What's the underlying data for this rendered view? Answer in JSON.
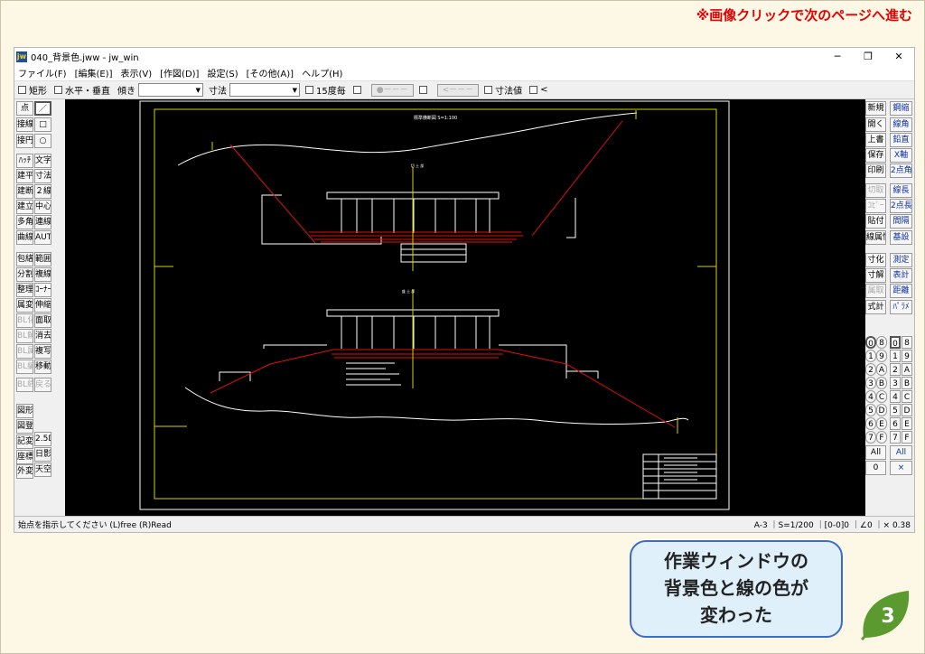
{
  "notice": "※画像クリックで次のページへ進む",
  "window": {
    "title": "040_背景色.jww - jw_win",
    "app_icon": "jw",
    "controls": [
      "─",
      "❐",
      "✕"
    ]
  },
  "menu": [
    "ファイル(F)",
    "[編集(E)]",
    "表示(V)",
    "[作図(D)]",
    "設定(S)",
    "[その他(A)]",
    "ヘルプ(H)"
  ],
  "toolbar": {
    "rect": "矩形",
    "hv": "水平・垂直",
    "tilt": "傾き",
    "dim": "寸法",
    "deg15": "15度毎",
    "circle_btn": "●－－－",
    "arrow_btn": "<－－－",
    "dimval": "寸法値",
    "lt": "<"
  },
  "left_tools": [
    "点",
    "／",
    "接線",
    "□",
    "接円",
    "○",
    "ﾊｯﾁ",
    "文字",
    "建平",
    "寸法",
    "建断",
    "２線",
    "建立",
    "中心線",
    "多角形",
    "連線",
    "曲線",
    "AUTO",
    "包絡",
    "範囲",
    "分割",
    "複線",
    "整理",
    "ｺｰﾅｰ",
    "属変",
    "伸縮",
    "BL化",
    "面取",
    "BL解",
    "消去",
    "BL属",
    "複写",
    "BL編",
    "移動",
    "BL終",
    "戻る",
    "図形",
    "図登",
    "記変",
    "2.5D",
    "座標",
    "日影",
    "外変",
    "天空"
  ],
  "right_tools": [
    "新規",
    "開く",
    "上書",
    "保存",
    "印刷",
    "切取",
    "ｺﾋﾟｰ",
    "貼付",
    "線属性",
    "寸化",
    "寸解",
    "属取",
    "式計",
    "All",
    "0"
  ],
  "right_tools2": [
    "鋼縮",
    "線角",
    "鉛直",
    "X軸",
    "2点角",
    "線長",
    "2点長",
    "間隔",
    "基設",
    "測定",
    "表計",
    "距離",
    "ﾊﾟﾗﾒ",
    "All",
    "×"
  ],
  "layer_labels": [
    "0",
    "1",
    "2",
    "3",
    "4",
    "5",
    "6",
    "7",
    "8",
    "9",
    "A",
    "B",
    "C",
    "D",
    "E",
    "F"
  ],
  "status": {
    "left": "始点を指示してください (L)free (R)Read",
    "right": "A-3 ｜S=1/200 ｜[0-0]0 ｜∠0 ｜× 0.38"
  },
  "drawing": {
    "title": "標準横断図 S=1:100",
    "section1": "切 土 部",
    "section2": "盛 土 部"
  },
  "callout": {
    "line1": "作業ウィンドウの",
    "line2": "背景色と線の色が",
    "line3": "変わった"
  },
  "page_number": "3",
  "colors": {
    "canvas_bg": "#000000",
    "frame": "#d4d400",
    "line": "#ffffff",
    "red": "#e01010",
    "accent_blue": "#3a6cc9",
    "leaf_green": "#5a9a2e",
    "notice": "#e60000"
  }
}
